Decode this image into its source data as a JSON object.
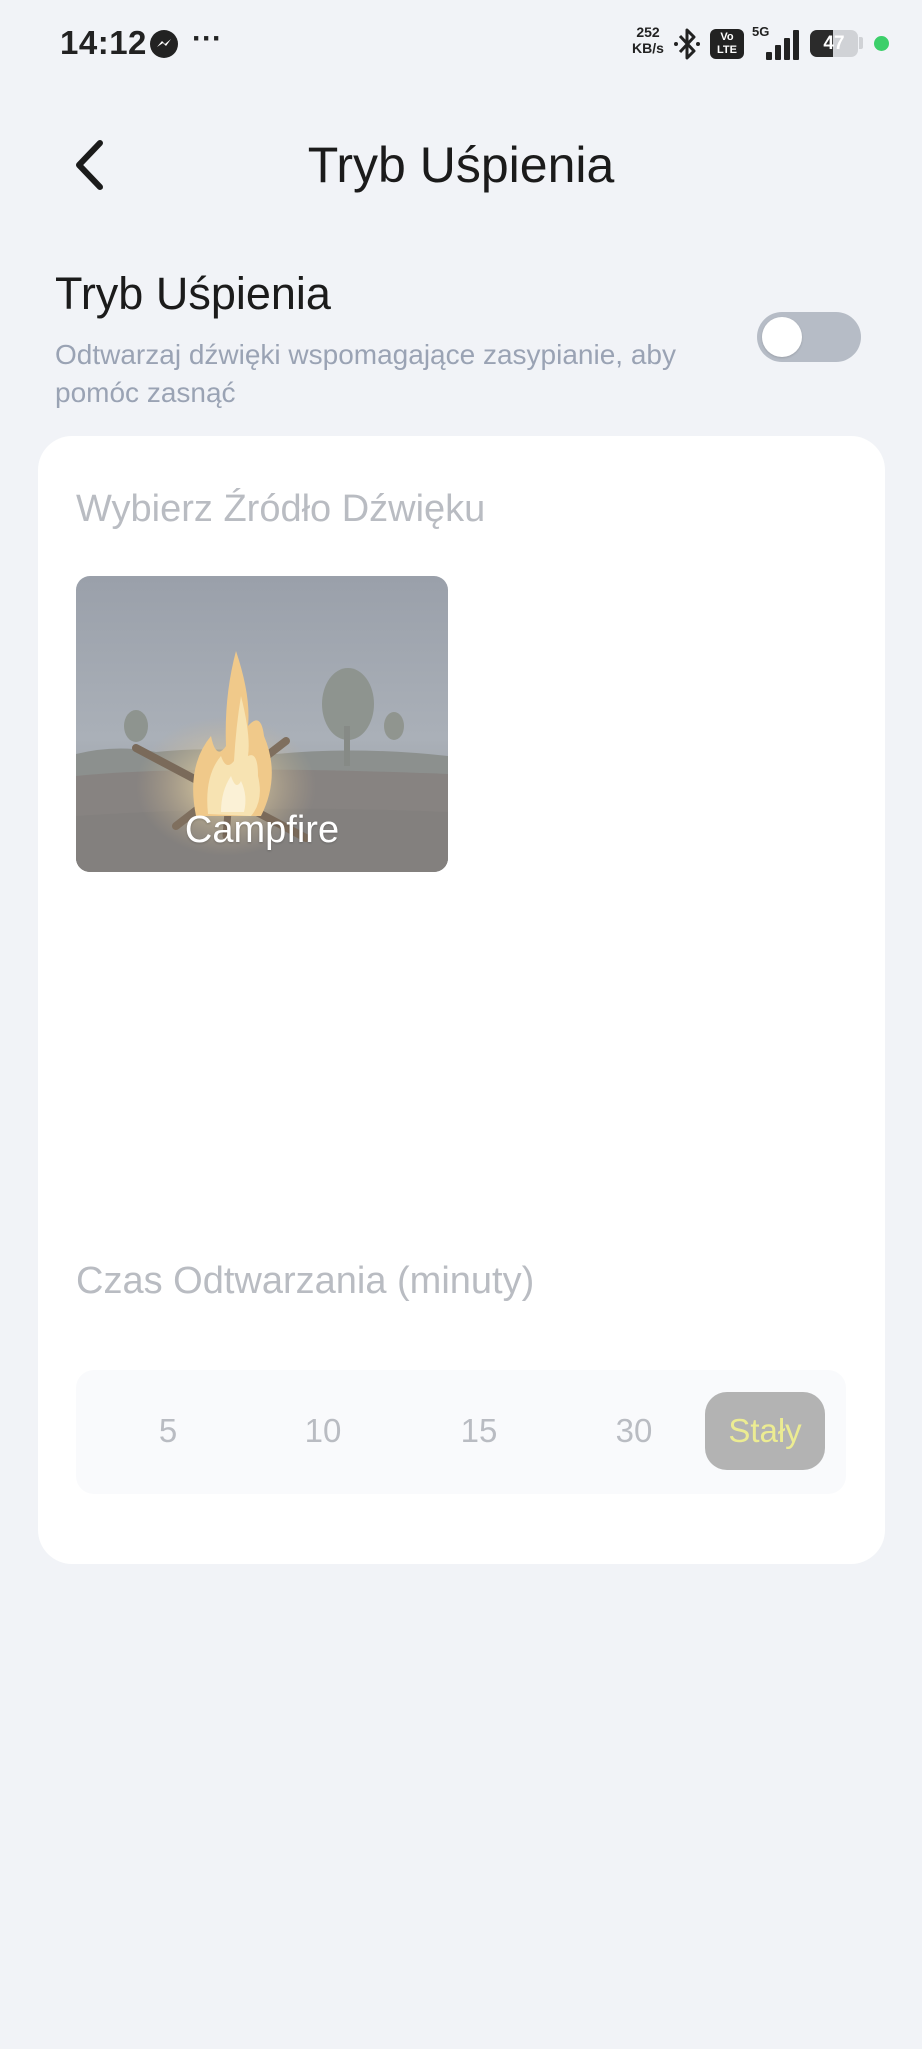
{
  "status_bar": {
    "time": "14:12",
    "more_dots": "···",
    "speed_value": "252",
    "speed_unit": "KB/s",
    "volte_line1": "Vo",
    "volte_line2": "LTE",
    "network": "5G",
    "battery": "47",
    "battery_level": 0.47,
    "dot_color": "#3ccf6a"
  },
  "header": {
    "title": "Tryb Uśpienia"
  },
  "sleep_mode": {
    "title": "Tryb Uśpienia",
    "description": "Odtwarzaj dźwięki wspomagające zasypianie, aby pomóc zasnąć",
    "enabled": false
  },
  "sound_source": {
    "label": "Wybierz Źródło Dźwięku",
    "items": [
      {
        "label": "Campfire"
      }
    ]
  },
  "duration": {
    "label": "Czas Odtwarzania (minuty)",
    "options": [
      "5",
      "10",
      "15",
      "30",
      "Stały"
    ],
    "selected": "Stały"
  },
  "colors": {
    "background": "#f1f3f7",
    "card": "#ffffff",
    "selected_option_bg": "#b3b3b3",
    "selected_option_text": "#ecec92",
    "toggle_off": "#b6bcc6"
  }
}
